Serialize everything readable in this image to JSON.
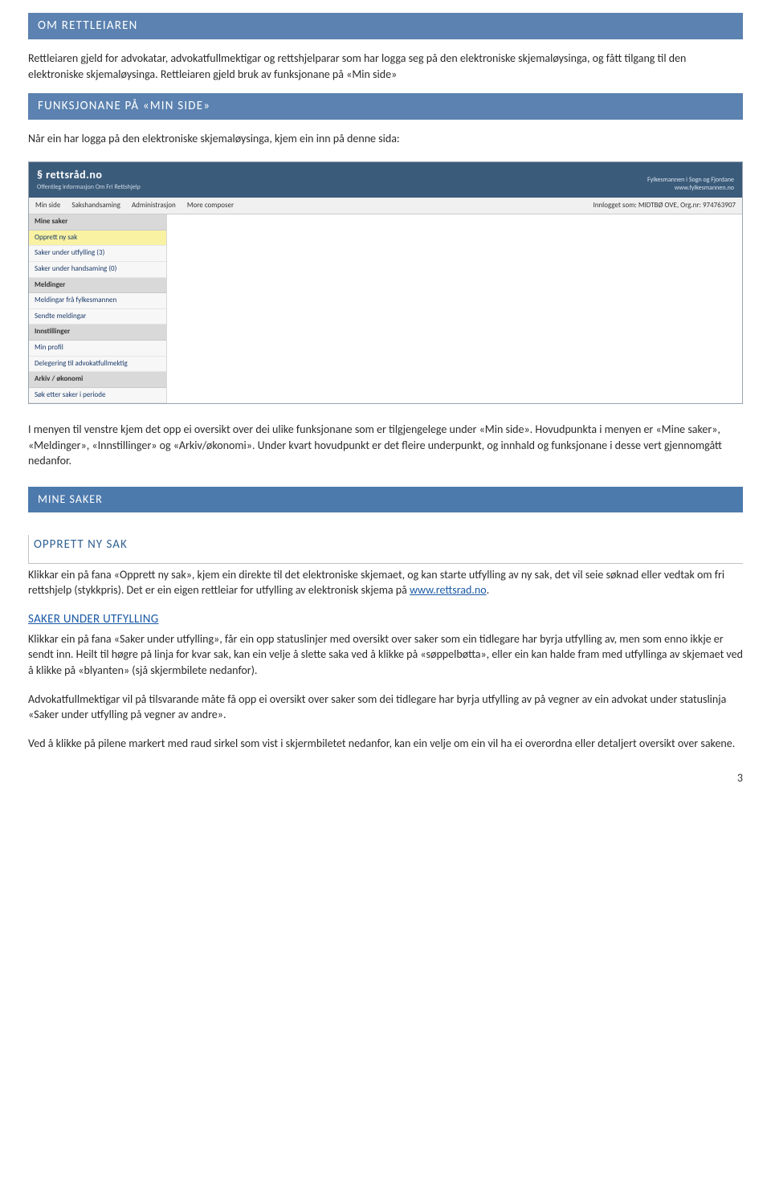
{
  "section1": {
    "title": "OM RETTLEIAREN"
  },
  "para1": "Rettleiaren gjeld for advokatar, advokatfullmektigar og rettshjelparar som har logga seg på den elektroniske skjemaløysinga, og fått tilgang til den elektroniske skjemaløysinga. Rettleiaren gjeld bruk av funksjonane på «Min side»",
  "section2": {
    "title": "FUNKSJONANE PÅ «MIN SIDE»"
  },
  "para2": "Når ein har logga på den elektroniske skjemaløysinga, kjem ein inn på denne sida:",
  "screenshot": {
    "logo_main": "§ rettsråd.no",
    "logo_sub": "Offentleg informasjon Om Fri Rettshjelp",
    "top_right_line1": "Fylkesmannen i Sogn og Fjordane",
    "top_right_line2": "www.fylkesmannen.no",
    "menu": [
      "Min side",
      "Sakshandsaming",
      "Administrasjon",
      "More composer"
    ],
    "menu_right": "Innlogget som: MIDTBØ OVE, Org.nr: 974763907",
    "side_groups": [
      {
        "head": "Mine saker",
        "items": [
          "Opprett ny sak",
          "Saker under utfylling (3)",
          "Saker under handsaming (0)"
        ]
      },
      {
        "head": "Meldinger",
        "items": [
          "Meldingar frå fylkesmannen",
          "Sendte meldingar"
        ]
      },
      {
        "head": "Innstillinger",
        "items": [
          "Min profil",
          "Delegering til advokatfullmektig"
        ]
      },
      {
        "head": "Arkiv / økonomi",
        "items": [
          "Søk etter saker i periode"
        ]
      }
    ]
  },
  "para3": "I menyen til venstre kjem det opp ei oversikt over dei ulike funksjonane som er tilgjengelege under «Min side». Hovudpunkta i menyen er «Mine saker», «Meldinger», «Innstillinger» og «Arkiv/økonomi». Under kvart hovudpunkt er det fleire underpunkt, og innhald og funksjonane i desse vert gjennomgått nedanfor.",
  "section3": {
    "title": "MINE SAKER"
  },
  "sub1": {
    "title": "OPPRETT NY SAK"
  },
  "sub1_text_a": "Klikkar ein på fana «Opprett ny sak», kjem ein direkte til det elektroniske skjemaet, og kan starte utfylling av ny sak, det vil seie søknad eller vedtak om fri rettshjelp (stykkpris). Det er ein eigen rettleiar for utfylling av elektronisk skjema på ",
  "sub1_link": "www.rettsrad.no",
  "sub1_text_b": ".",
  "sub2": {
    "title": "SAKER UNDER UTFYLLING"
  },
  "sub2_p1": "Klikkar ein på fana «Saker under utfylling», får ein opp statuslinjer med oversikt over saker som ein tidlegare har byrja utfylling av, men som enno ikkje er sendt inn. Heilt til høgre på linja for kvar sak, kan ein velje å slette saka ved å klikke på «søppelbøtta», eller ein kan halde fram med utfyllinga av skjemaet ved å klikke på «blyanten» (sjå skjermbilete nedanfor).",
  "sub2_p2": "Advokatfullmektigar vil på tilsvarande måte få opp ei oversikt over saker som dei tidlegare har byrja utfylling av på vegner av ein advokat under statuslinja «Saker under utfylling på vegner av andre».",
  "sub2_p3": "Ved å klikke på pilene markert med raud sirkel som vist i skjermbiletet nedanfor, kan ein velje om ein vil ha ei overordna eller detaljert oversikt over sakene.",
  "page_number": "3"
}
